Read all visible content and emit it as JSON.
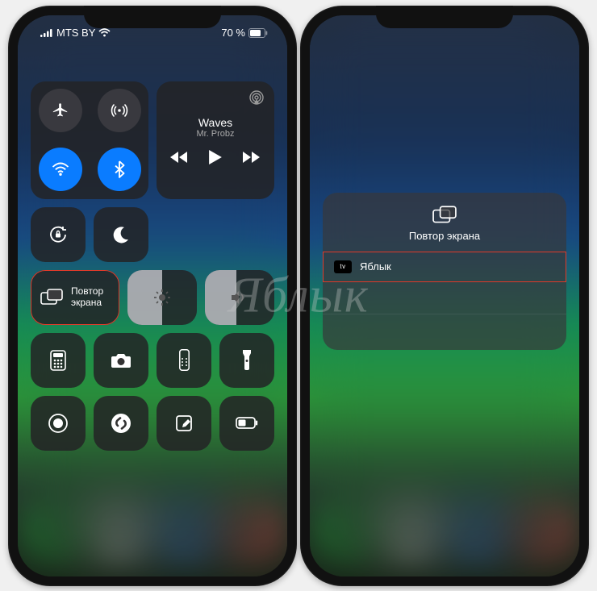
{
  "statusbar": {
    "carrier": "MTS BY",
    "battery_pct": "70 %"
  },
  "music": {
    "title": "Waves",
    "artist": "Mr. Probz"
  },
  "mirror_tile": {
    "line1": "Повтор",
    "line2": "экрана"
  },
  "brightness_fill": 0.5,
  "volume_fill": 0.45,
  "mirror_panel": {
    "title": "Повтор экрана",
    "device": "Яблык",
    "device_badge": "tv"
  },
  "watermark": "Яблык",
  "colors": {
    "blue": "#0a7cff",
    "highlight": "#e03a2a",
    "module": "rgba(35,35,38,.85)"
  }
}
